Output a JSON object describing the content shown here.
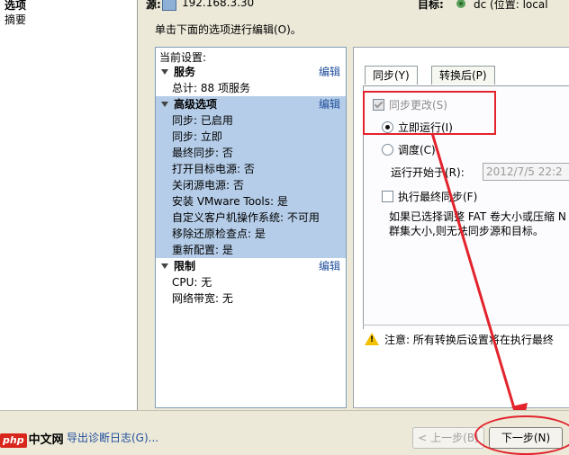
{
  "nav": {
    "items": [
      "选项",
      "摘要"
    ]
  },
  "header": {
    "source_label": "源:",
    "source_value": "192.168.3.30",
    "target_label": "目标:",
    "target_value": "dc (位置: local"
  },
  "instruction": "单击下面的选项进行编辑(O)。",
  "current_settings": {
    "title": "当前设置:",
    "sections": [
      {
        "title": "服务",
        "edit": "编辑",
        "items": [
          "总计: 88 项服务"
        ]
      },
      {
        "title": "高级选项",
        "edit": "编辑",
        "items": [
          "同步: 已启用",
          "同步: 立即",
          "最终同步: 否",
          "打开目标电源: 否",
          "关闭源电源: 否",
          "安装 VMware Tools: 是",
          "自定义客户机操作系统: 不可用",
          "移除还原检查点: 是",
          "重新配置: 是"
        ]
      },
      {
        "title": "限制",
        "edit": "编辑",
        "items": [
          "CPU: 无",
          "网络带宽: 无"
        ]
      }
    ]
  },
  "tabs": [
    "同步(Y)",
    "转换后(P)"
  ],
  "sync": {
    "sync_changes": "同步更改(S)",
    "run_now": "立即运行(I)",
    "schedule": "调度(C)",
    "start_at_label": "运行开始于(R):",
    "start_at_value": "2012/7/5 22:2",
    "final_sync": "执行最终同步(F)",
    "note": "如果已选择调整 FAT 卷大小或压缩 N 改群集大小,则无法同步源和目标。",
    "warning": "注意: 所有转换后设置将在执行最终"
  },
  "footer": {
    "export_link": "导出诊断日志(G)...",
    "back_button": "< 上一步(B)",
    "next_button": "下一步(N)"
  },
  "watermark": {
    "logo": "php",
    "text": "中文网"
  },
  "colors": {
    "annotation_red": "#e3232c",
    "selection_blue": "#b5cde8",
    "link_blue": "#1f4e9d"
  }
}
